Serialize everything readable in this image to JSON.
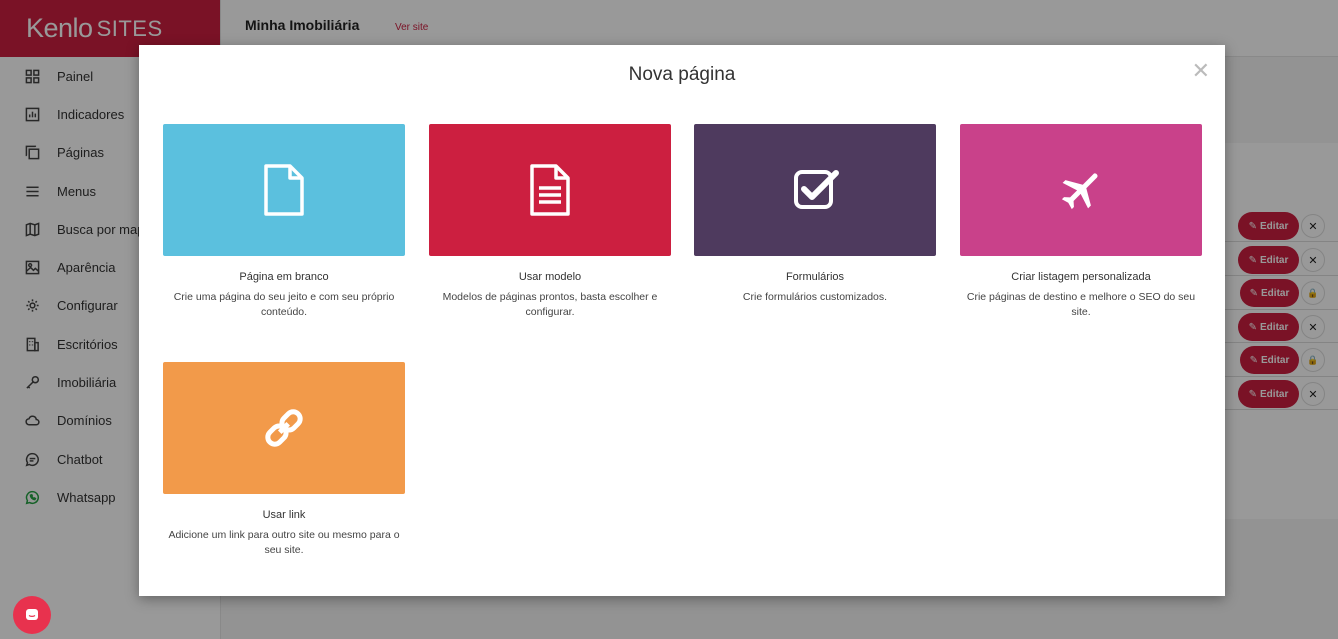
{
  "brand": {
    "logo_main": "Kenlo",
    "logo_sub": "SITES",
    "color": "#cc1f40"
  },
  "topbar": {
    "site_name": "Minha Imobiliária",
    "view_link": "Ver site"
  },
  "sidebar": {
    "items": [
      {
        "label": "Painel",
        "icon": "dashboard-icon"
      },
      {
        "label": "Indicadores",
        "icon": "chart-icon"
      },
      {
        "label": "Páginas",
        "icon": "pages-icon"
      },
      {
        "label": "Menus",
        "icon": "menu-icon"
      },
      {
        "label": "Busca por mapa",
        "icon": "map-icon"
      },
      {
        "label": "Aparência",
        "icon": "image-icon"
      },
      {
        "label": "Configurar",
        "icon": "gear-icon"
      },
      {
        "label": "Escritórios",
        "icon": "building-icon"
      },
      {
        "label": "Imobiliária",
        "icon": "key-icon"
      },
      {
        "label": "Domínios",
        "icon": "cloud-icon"
      },
      {
        "label": "Chatbot",
        "icon": "chat-icon"
      },
      {
        "label": "Whatsapp",
        "icon": "whatsapp-icon"
      }
    ]
  },
  "background_rows": {
    "edit_label": "Editar",
    "rows": [
      {
        "action": "delete"
      },
      {
        "action": "delete"
      },
      {
        "action": "locked"
      },
      {
        "action": "delete"
      },
      {
        "action": "locked"
      },
      {
        "action": "delete"
      }
    ]
  },
  "modal": {
    "title": "Nova página",
    "close_icon": "close-icon",
    "options": [
      {
        "title": "Página em branco",
        "description": "Crie uma página do seu jeito e com seu próprio conteúdo.",
        "color": "#5bc0de",
        "icon": "blank-page-icon"
      },
      {
        "title": "Usar modelo",
        "description": "Modelos de páginas prontos, basta escolher e configurar.",
        "color": "#cc1f40",
        "icon": "document-icon"
      },
      {
        "title": "Formulários",
        "description": "Crie formulários customizados.",
        "color": "#4e3a5e",
        "icon": "checkbox-icon"
      },
      {
        "title": "Criar listagem personalizada",
        "description": "Crie páginas de destino e melhore o SEO do seu site.",
        "color": "#c9418a",
        "icon": "plane-icon"
      },
      {
        "title": "Usar link",
        "description": "Adicione um link para outro site ou mesmo para o seu site.",
        "color": "#f29a4a",
        "icon": "link-icon"
      }
    ]
  }
}
